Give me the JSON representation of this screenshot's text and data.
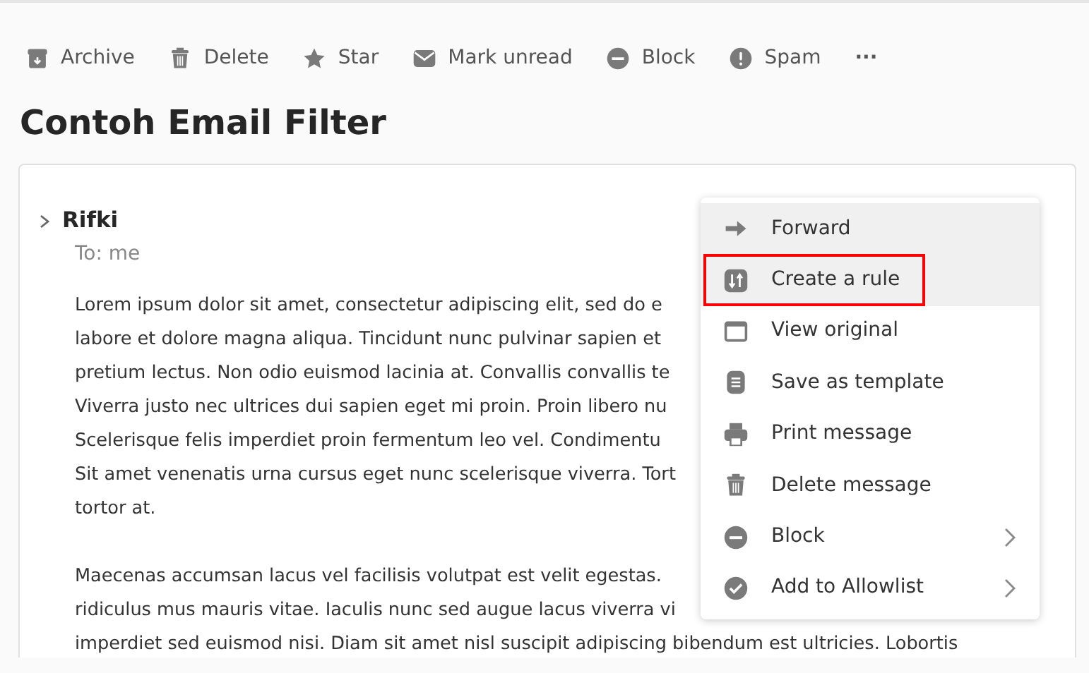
{
  "toolbar": [
    {
      "label": "Archive"
    },
    {
      "label": "Delete"
    },
    {
      "label": "Star"
    },
    {
      "label": "Mark unread"
    },
    {
      "label": "Block"
    },
    {
      "label": "Spam"
    }
  ],
  "more_label": "···",
  "title": "Contoh Email Filter",
  "message": {
    "sender": "Rifki",
    "expanded": false,
    "to": "To: me",
    "paragraphs": [
      [
        "Lorem ipsum dolor sit amet, consectetur adipiscing elit, sed do e",
        "labore et dolore magna aliqua. Tincidunt nunc pulvinar sapien et",
        "pretium lectus. Non odio euismod lacinia at. Convallis convallis te",
        "Viverra justo nec ultrices dui sapien eget mi proin. Proin libero nu",
        "Scelerisque felis imperdiet proin fermentum leo vel. Condimentu",
        "Sit amet venenatis urna cursus eget nunc scelerisque viverra. Tort",
        "tortor at."
      ],
      [
        "Maecenas accumsan lacus vel facilisis volutpat est velit egestas.",
        "ridiculus mus mauris vitae. Iaculis nunc sed augue lacus viverra vi",
        "imperdiet sed euismod nisi. Diam sit amet nisl suscipit adipiscing bibendum est ultricies. Lobortis"
      ]
    ]
  },
  "menu": [
    {
      "label": "Forward",
      "highlighted": true,
      "outlined": false,
      "submenu": false
    },
    {
      "label": "Create a rule",
      "highlighted": true,
      "outlined": true,
      "submenu": false
    },
    {
      "label": "View original",
      "highlighted": false,
      "outlined": false,
      "submenu": false
    },
    {
      "label": "Save as template",
      "highlighted": false,
      "outlined": false,
      "submenu": false
    },
    {
      "label": "Print message",
      "highlighted": false,
      "outlined": false,
      "submenu": false
    },
    {
      "label": "Delete message",
      "highlighted": false,
      "outlined": false,
      "submenu": false
    },
    {
      "label": "Block",
      "highlighted": false,
      "outlined": false,
      "submenu": true
    },
    {
      "label": "Add to Allowlist",
      "highlighted": false,
      "outlined": false,
      "submenu": true
    }
  ]
}
